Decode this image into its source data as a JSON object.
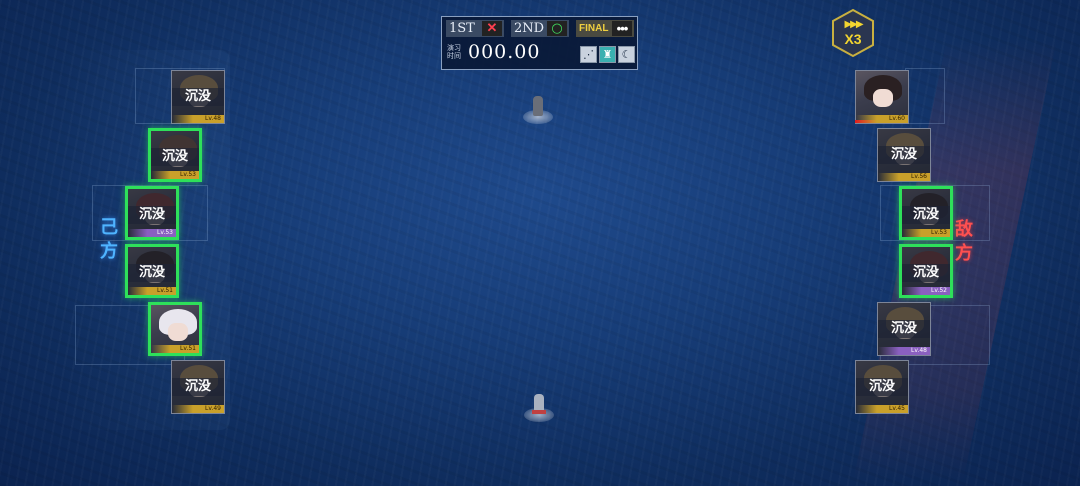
{
  "score": {
    "round1_label": "1ST",
    "round1_mark": "✕",
    "round2_label": "2ND",
    "round2_mark": "○",
    "round3_label": "FINAL",
    "round3_mark": "•••",
    "time_label": "演习时间",
    "time_value": "000.00",
    "icons": [
      "formation-icon",
      "fleet-icon",
      "night-moon-icon"
    ]
  },
  "speed": {
    "arrows": "▶▶▶",
    "label": "X3",
    "color": "#f3d530"
  },
  "sides": {
    "ally_label": "己方",
    "enemy_label": "敌方",
    "ally_color": "#4fb4ff",
    "enemy_color": "#ff5050"
  },
  "ally_cards": [
    {
      "status": "沉没",
      "level": "Lv.48"
    },
    {
      "status": "沉没",
      "level": "Lv.53"
    },
    {
      "status": "沉没",
      "level": "Lv.53"
    },
    {
      "status": "沉没",
      "level": "Lv.51"
    },
    {
      "status": "",
      "level": "Lv.51"
    },
    {
      "status": "沉没",
      "level": "Lv.49"
    }
  ],
  "enemy_cards": [
    {
      "status": "",
      "level": "Lv.60"
    },
    {
      "status": "沉没",
      "level": "Lv.56"
    },
    {
      "status": "沉没",
      "level": "Lv.53"
    },
    {
      "status": "沉没",
      "level": "Lv.52"
    },
    {
      "status": "沉没",
      "level": "Lv.48"
    },
    {
      "status": "沉没",
      "level": "Lv.45"
    }
  ],
  "colors": {
    "active_border": "#2ee05a",
    "sea": "#173d78"
  }
}
